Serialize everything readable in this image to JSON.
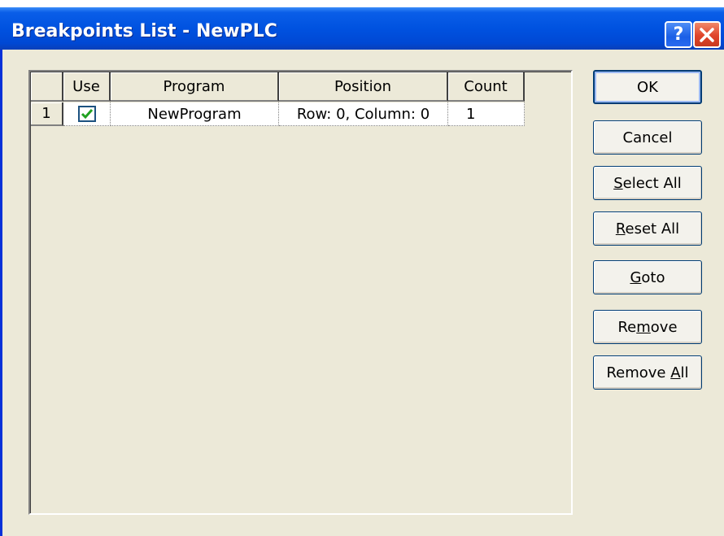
{
  "window": {
    "title": "Breakpoints List - NewPLC",
    "help_label": "?"
  },
  "grid": {
    "columns": [
      "",
      "Use",
      "Program",
      "Position",
      "Count"
    ],
    "rows": [
      {
        "number": "1",
        "use_checked": true,
        "program": "NewProgram",
        "position": "Row: 0, Column: 0",
        "count": "1"
      }
    ]
  },
  "buttons": {
    "ok": "OK",
    "cancel": "Cancel",
    "select_all": {
      "pre": "",
      "accel": "S",
      "post": "elect All"
    },
    "reset_all": {
      "pre": "",
      "accel": "R",
      "post": "eset All"
    },
    "goto": {
      "pre": "",
      "accel": "G",
      "post": "oto"
    },
    "remove": {
      "pre": "Re",
      "accel": "m",
      "post": "ove"
    },
    "remove_all": {
      "pre": "Remove ",
      "accel": "A",
      "post": "ll"
    }
  },
  "colors": {
    "titlebar": "#0052e0",
    "dialog_bg": "#ece9d8",
    "check": "#21a121",
    "close_button": "#e0442a"
  },
  "icons": {
    "help": "help-icon",
    "close": "close-icon",
    "check": "checkmark-icon"
  }
}
